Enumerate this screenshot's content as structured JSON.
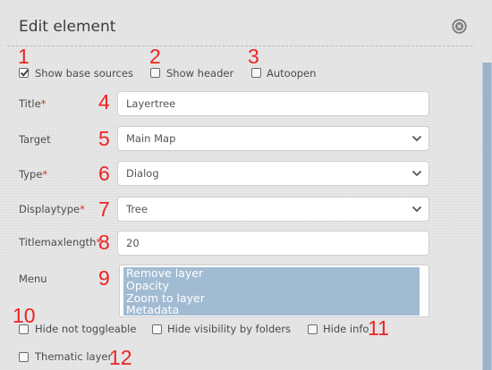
{
  "dialog": {
    "title": "Edit element"
  },
  "annotations": [
    "1",
    "2",
    "3",
    "4",
    "5",
    "6",
    "7",
    "8",
    "9",
    "10",
    "11",
    "12"
  ],
  "top_checkboxes": [
    {
      "label": "Show base sources",
      "checked": true
    },
    {
      "label": "Show header",
      "checked": false
    },
    {
      "label": "Autoopen",
      "checked": false
    }
  ],
  "fields": {
    "title": {
      "label": "Title",
      "required_mark": "*",
      "value": "Layertree"
    },
    "target": {
      "label": "Target",
      "value": "Main Map"
    },
    "type": {
      "label": "Type",
      "required_mark": "*",
      "value": "Dialog"
    },
    "displaytype": {
      "label": "Displaytype",
      "required_mark": "*",
      "value": "Tree"
    },
    "titlemaxlength": {
      "label": "Titlemaxlength",
      "required_mark": "*",
      "value": "20"
    },
    "menu": {
      "label": "Menu",
      "options": [
        "Remove layer",
        "Opacity",
        "Zoom to layer",
        "Metadata"
      ]
    }
  },
  "bottom_checkboxes": [
    {
      "label": "Hide not toggleable",
      "checked": false
    },
    {
      "label": "Hide visibility by folders",
      "checked": false
    },
    {
      "label": "Hide info",
      "checked": false
    },
    {
      "label": "Thematic layer",
      "checked": false
    }
  ],
  "colors": {
    "annotation": "#ee2222",
    "required": "#c8372d",
    "selected_option_bg": "#a1bbd2",
    "scrollbar": "#9db2c8"
  }
}
